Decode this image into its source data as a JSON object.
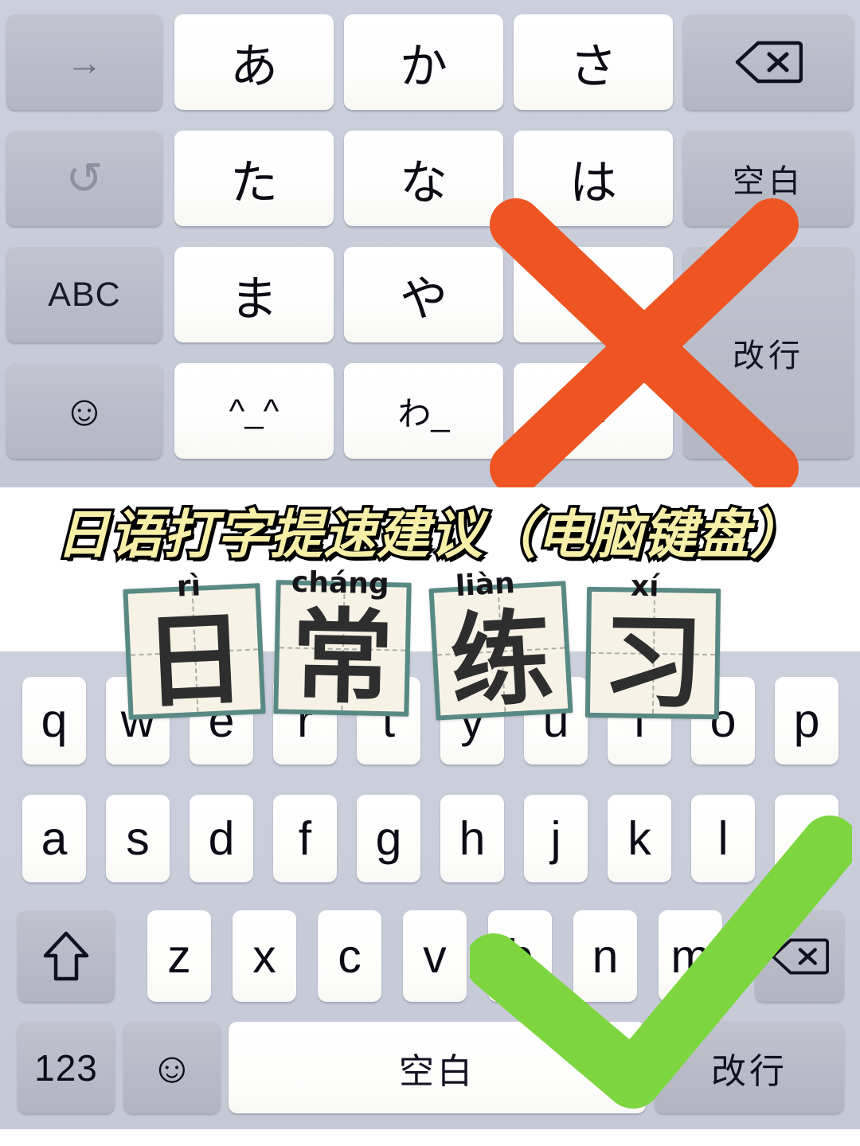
{
  "title": {
    "text": "日语打字提速建议（电脑键盘）",
    "color": "#F7EFA8",
    "outline": "#000000"
  },
  "kana_keyboard": {
    "name": "japanese-12-key-kana-keyboard",
    "background": "#C9CDDA",
    "marked_wrong": true,
    "keys": [
      {
        "id": "cursor-right",
        "label": "→",
        "type": "function"
      },
      {
        "id": "kana-a",
        "label": "あ",
        "type": "kana"
      },
      {
        "id": "kana-ka",
        "label": "か",
        "type": "kana"
      },
      {
        "id": "kana-sa",
        "label": "さ",
        "type": "kana"
      },
      {
        "id": "backspace",
        "label": "⌫",
        "type": "function"
      },
      {
        "id": "undo",
        "label": "↺",
        "type": "function"
      },
      {
        "id": "kana-ta",
        "label": "た",
        "type": "kana"
      },
      {
        "id": "kana-na",
        "label": "な",
        "type": "kana"
      },
      {
        "id": "kana-ha",
        "label": "は",
        "type": "kana"
      },
      {
        "id": "space",
        "label": "空白",
        "type": "function"
      },
      {
        "id": "abc-switch",
        "label": "ABC",
        "type": "function"
      },
      {
        "id": "kana-ma",
        "label": "ま",
        "type": "kana"
      },
      {
        "id": "kana-ya",
        "label": "や",
        "type": "kana"
      },
      {
        "id": "kana-ra",
        "label": "",
        "type": "kana"
      },
      {
        "id": "return",
        "label": "改行",
        "type": "function"
      },
      {
        "id": "emoji",
        "label": "☺",
        "type": "function"
      },
      {
        "id": "kaomoji",
        "label": "^_^",
        "type": "kana"
      },
      {
        "id": "kana-wa",
        "label": "わ_",
        "type": "kana"
      },
      {
        "id": "punctuation",
        "label": "?!",
        "type": "kana"
      }
    ]
  },
  "qwerty_keyboard": {
    "name": "qwerty-keyboard",
    "background": "#C9CDDA",
    "marked_correct": true,
    "row1": [
      "q",
      "w",
      "e",
      "r",
      "t",
      "y",
      "u",
      "i",
      "o",
      "p"
    ],
    "row2": [
      "a",
      "s",
      "d",
      "f",
      "g",
      "h",
      "j",
      "k",
      "l",
      "_"
    ],
    "row3": [
      "z",
      "x",
      "c",
      "v",
      "b",
      "n",
      "m"
    ],
    "shift_label": "⇧",
    "backspace_label": "⌫",
    "bottom": {
      "numbers_label": "123",
      "emoji_label": "☺",
      "space_label": "空白",
      "return_label": "改行"
    }
  },
  "flashcards": {
    "name": "chinese-flashcards",
    "border_color": "#588984",
    "paper_color": "#F6F3E6",
    "items": [
      {
        "pinyin": "rì",
        "char": "日"
      },
      {
        "pinyin": "cháng",
        "char": "常"
      },
      {
        "pinyin": "liàn",
        "char": "练"
      },
      {
        "pinyin": "xí",
        "char": "习"
      }
    ]
  },
  "marks": {
    "cross": {
      "name": "red-cross-mark",
      "color": "#EE5522",
      "meaning": "not recommended"
    },
    "check": {
      "name": "green-check-mark",
      "color": "#7DD63F",
      "meaning": "recommended"
    }
  }
}
